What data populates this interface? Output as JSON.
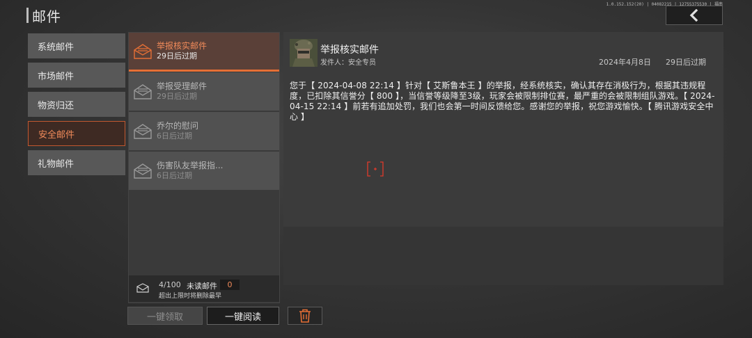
{
  "header": {
    "title": "邮件",
    "version": "1.0.152.152(20) | 04082215 | 12755375530 | 福南"
  },
  "sidebar": {
    "items": [
      {
        "label": "系统邮件"
      },
      {
        "label": "市场邮件"
      },
      {
        "label": "物资归还"
      },
      {
        "label": "安全邮件"
      },
      {
        "label": "礼物邮件"
      }
    ],
    "active_index": 3
  },
  "mail_list": {
    "items": [
      {
        "title": "举报核实邮件",
        "expiry": "29日后过期"
      },
      {
        "title": "举报受理邮件",
        "expiry": "29日后过期"
      },
      {
        "title": "乔尔的慰问",
        "expiry": "6日后过期"
      },
      {
        "title": "伤害队友举报指...",
        "expiry": "6日后过期"
      }
    ],
    "footer": {
      "count": "4/100",
      "unread_label": "未读邮件",
      "unread_count": "0",
      "note": "超出上限时将删除最早"
    }
  },
  "buttons": {
    "claim_all": "一键领取",
    "read_all": "一键阅读"
  },
  "detail": {
    "title": "举报核实邮件",
    "sender": "发件人：安全专员",
    "date": "2024年4月8日",
    "expiry": "29日后过期",
    "body": "您于【 2024-04-08 22:14 】针对【 艾斯鲁本王 】的举报，经系统核实，确认其存在消极行为，根据其违规程度，已扣除其信誉分【 800 】，当信誉等级降至3级，玩家会被限制排位赛，最严重的会被限制组队游戏。【 2024-04-15 22:14 】前若有追加处罚，我们也会第一时间反馈给您。感谢您的举报，祝您游戏愉快。【 腾讯游戏安全中心 】"
  },
  "colors": {
    "accent": "#e56f35",
    "active_text": "#f08a5a",
    "crosshair": "#e0392b"
  }
}
